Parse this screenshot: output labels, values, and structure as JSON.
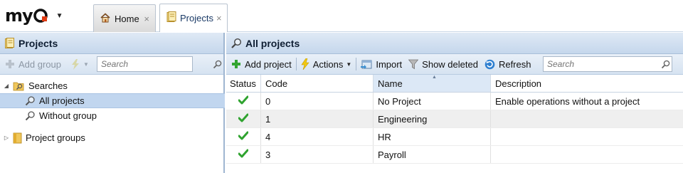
{
  "app": {
    "logo": "myq",
    "colors": {
      "header_bg": "#c5d7ec",
      "selected_row": "#c1d6ef",
      "check_green": "#2fa32f",
      "logo_accent": "#e03a12"
    }
  },
  "tabs": [
    {
      "label": "Home",
      "icon": "home-icon",
      "close": "×"
    },
    {
      "label": "Projects",
      "icon": "projects-icon",
      "close": "×"
    }
  ],
  "left": {
    "title": "Projects",
    "toolbar": {
      "add_group": "Add group",
      "search_placeholder": "Search"
    },
    "tree": {
      "searches": "Searches",
      "all_projects": "All projects",
      "without_group": "Without group",
      "project_groups": "Project groups"
    }
  },
  "right": {
    "title": "All projects",
    "toolbar": {
      "add_project": "Add project",
      "actions": "Actions",
      "import": "Import",
      "show_deleted": "Show deleted",
      "refresh": "Refresh",
      "search_placeholder": "Search"
    },
    "columns": {
      "status": "Status",
      "code": "Code",
      "name": "Name",
      "description": "Description"
    },
    "rows": [
      {
        "status": "check",
        "code": "0",
        "name": "No Project",
        "description": "Enable operations without a project"
      },
      {
        "status": "check",
        "code": "1",
        "name": "Engineering",
        "description": ""
      },
      {
        "status": "check",
        "code": "4",
        "name": "HR",
        "description": ""
      },
      {
        "status": "check",
        "code": "3",
        "name": "Payroll",
        "description": ""
      }
    ]
  }
}
